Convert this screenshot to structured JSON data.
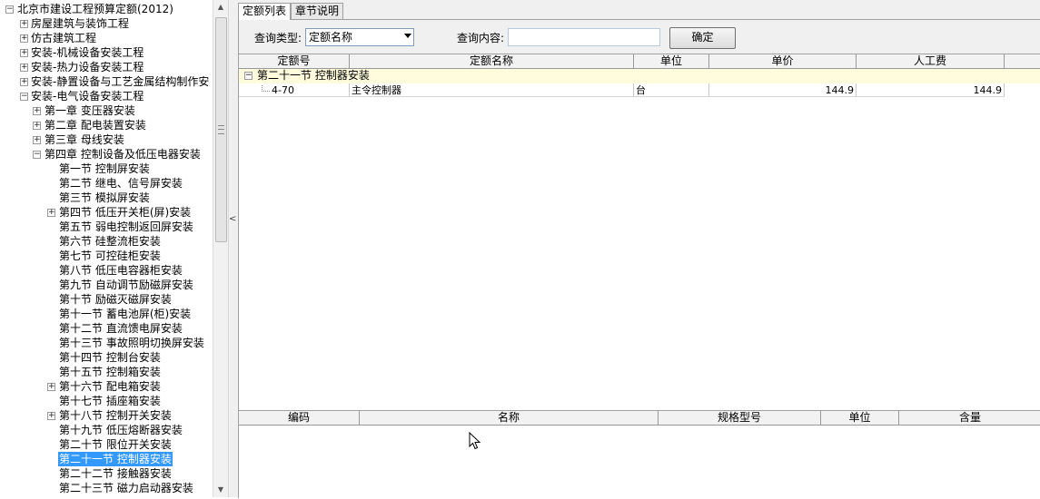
{
  "tree": {
    "root_label": "北京市建设工程预算定额(2012)",
    "items": [
      {
        "label": "北京市建设工程预算定额(2012)",
        "level": 0,
        "toggle": "minus"
      },
      {
        "label": "房屋建筑与装饰工程",
        "level": 1,
        "toggle": "plus"
      },
      {
        "label": "仿古建筑工程",
        "level": 1,
        "toggle": "plus"
      },
      {
        "label": "安装-机械设备安装工程",
        "level": 1,
        "toggle": "plus"
      },
      {
        "label": "安装-热力设备安装工程",
        "level": 1,
        "toggle": "plus"
      },
      {
        "label": "安装-静置设备与工艺金属结构制作安",
        "level": 1,
        "toggle": "plus"
      },
      {
        "label": "安装-电气设备安装工程",
        "level": 1,
        "toggle": "minus"
      },
      {
        "label": "第一章 变压器安装",
        "level": 2,
        "toggle": "plus"
      },
      {
        "label": "第二章 配电装置安装",
        "level": 2,
        "toggle": "plus"
      },
      {
        "label": "第三章 母线安装",
        "level": 2,
        "toggle": "plus"
      },
      {
        "label": "第四章 控制设备及低压电器安装",
        "level": 2,
        "toggle": "minus"
      },
      {
        "label": "第一节 控制屏安装",
        "level": 3,
        "toggle": ""
      },
      {
        "label": "第二节 继电、信号屏安装",
        "level": 3,
        "toggle": ""
      },
      {
        "label": "第三节 模拟屏安装",
        "level": 3,
        "toggle": ""
      },
      {
        "label": "第四节 低压开关柜(屏)安装",
        "level": 3,
        "toggle": "plus"
      },
      {
        "label": "第五节 弱电控制返回屏安装",
        "level": 3,
        "toggle": ""
      },
      {
        "label": "第六节 硅整流柜安装",
        "level": 3,
        "toggle": ""
      },
      {
        "label": "第七节 可控硅柜安装",
        "level": 3,
        "toggle": ""
      },
      {
        "label": "第八节 低压电容器柜安装",
        "level": 3,
        "toggle": ""
      },
      {
        "label": "第九节 自动调节励磁屏安装",
        "level": 3,
        "toggle": ""
      },
      {
        "label": "第十节 励磁灭磁屏安装",
        "level": 3,
        "toggle": ""
      },
      {
        "label": "第十一节 蓄电池屏(柜)安装",
        "level": 3,
        "toggle": ""
      },
      {
        "label": "第十二节 直流馈电屏安装",
        "level": 3,
        "toggle": ""
      },
      {
        "label": "第十三节 事故照明切换屏安装",
        "level": 3,
        "toggle": ""
      },
      {
        "label": "第十四节 控制台安装",
        "level": 3,
        "toggle": ""
      },
      {
        "label": "第十五节 控制箱安装",
        "level": 3,
        "toggle": ""
      },
      {
        "label": "第十六节 配电箱安装",
        "level": 3,
        "toggle": "plus"
      },
      {
        "label": "第十七节 插座箱安装",
        "level": 3,
        "toggle": ""
      },
      {
        "label": "第十八节 控制开关安装",
        "level": 3,
        "toggle": "plus"
      },
      {
        "label": "第十九节 低压熔断器安装",
        "level": 3,
        "toggle": ""
      },
      {
        "label": "第二十节 限位开关安装",
        "level": 3,
        "toggle": ""
      },
      {
        "label": "第二十一节 控制器安装",
        "level": 3,
        "toggle": "",
        "selected": true
      },
      {
        "label": "第二十二节 接触器安装",
        "level": 3,
        "toggle": ""
      },
      {
        "label": "第二十三节 磁力启动器安装",
        "level": 3,
        "toggle": ""
      }
    ]
  },
  "tabs": {
    "list": "定额列表",
    "notes": "章节说明"
  },
  "query": {
    "type_label": "查询类型:",
    "type_value": "定额名称",
    "content_label": "查询内容:",
    "content_value": "",
    "confirm": "确定"
  },
  "main_table": {
    "headers": [
      "定额号",
      "定额名称",
      "单位",
      "单价",
      "人工费"
    ],
    "group_label": "第二十一节 控制器安装",
    "rows": [
      {
        "code": "4-70",
        "name": "主令控制器",
        "unit": "台",
        "price": "144.9",
        "labor": "144.9"
      }
    ]
  },
  "sub_table": {
    "headers": [
      "编码",
      "名称",
      "规格型号",
      "单位",
      "含量"
    ]
  },
  "icons": {
    "expand_plus": "plus-box-icon",
    "collapse_minus": "minus-box-icon",
    "scroll_up": "arrow-up-icon",
    "scroll_down": "arrow-down-icon",
    "splitter": "chevron-left-icon",
    "cursor": "mouse-pointer-icon"
  },
  "colors": {
    "selection": "#3399ff",
    "group_row": "#fffbdc",
    "panel_bg": "#f0f0f0"
  }
}
